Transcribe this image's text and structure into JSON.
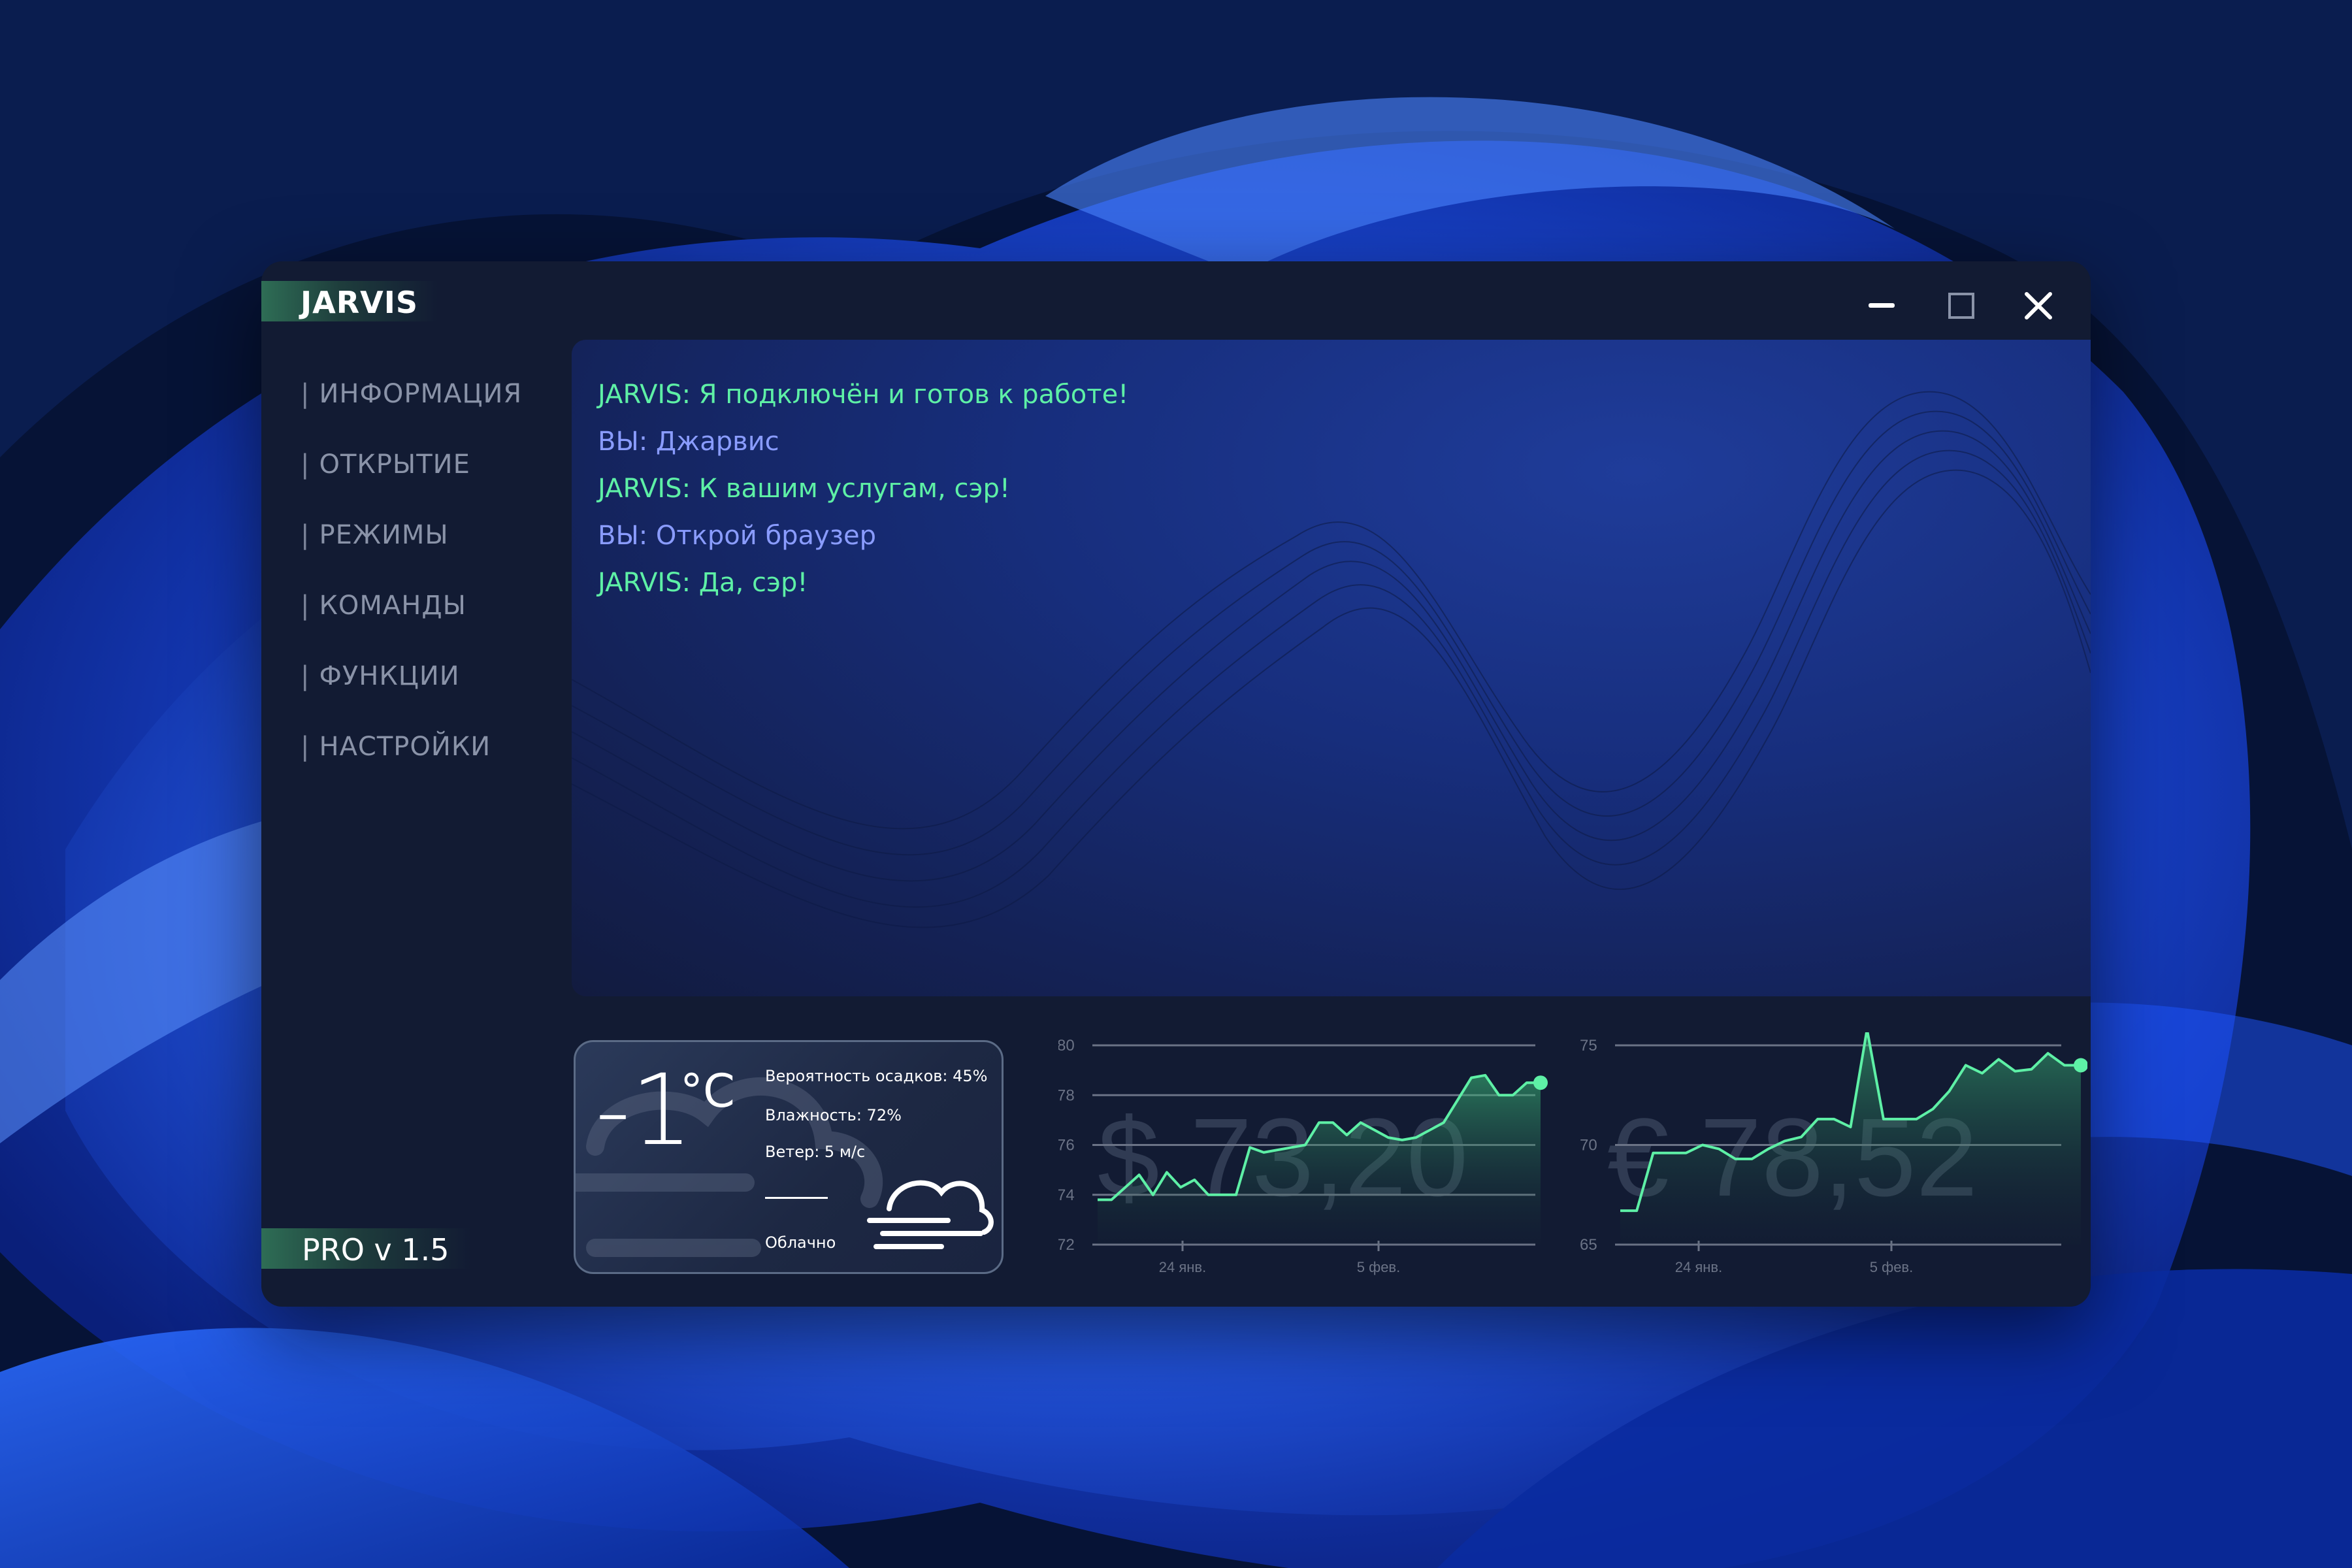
{
  "window": {
    "title": "JARVIS",
    "controls": {
      "minimize": "minimize-icon",
      "maximize": "maximize-icon",
      "close": "close-icon"
    }
  },
  "sidebar": {
    "items": [
      {
        "label": "ИНФОРМАЦИЯ"
      },
      {
        "label": "ОТКРЫТИЕ"
      },
      {
        "label": "РЕЖИМЫ"
      },
      {
        "label": "КОМАНДЫ"
      },
      {
        "label": "ФУНКЦИИ"
      },
      {
        "label": "НАСТРОЙКИ"
      }
    ],
    "version": "PRO v 1.5"
  },
  "chat": {
    "messages": [
      {
        "speaker": "jarvis",
        "text": "JARVIS: Я подключён и готов к работе!"
      },
      {
        "speaker": "user",
        "text": "ВЫ: Джарвис"
      },
      {
        "speaker": "jarvis",
        "text": "JARVIS: К вашим услугам, сэр!"
      },
      {
        "speaker": "user",
        "text": "ВЫ: Открой браузер"
      },
      {
        "speaker": "jarvis",
        "text": "JARVIS: Да, сэр!"
      }
    ]
  },
  "weather": {
    "temperature": "-1",
    "unit": "°C",
    "precipitation": "Вероятность осадков: 45%",
    "humidity": "Влажность: 72%",
    "wind": "Ветер: 5 м/с",
    "condition": "Облачно",
    "icon": "cloud-wind-icon"
  },
  "colors": {
    "accent_green": "#5ef0a6",
    "user_blue": "#8a9cff",
    "window_bg": "#121b33"
  },
  "chart_data": [
    {
      "type": "area",
      "big_label": "$ 73,20",
      "ylim": [
        72,
        80
      ],
      "yticks": [
        "80",
        "78",
        "76",
        "74",
        "72"
      ],
      "xticks": [
        "24 янв.",
        "5 фев."
      ],
      "x": [
        0,
        1,
        2,
        3,
        4,
        5,
        6,
        7,
        8,
        9,
        10,
        11,
        12,
        13,
        14,
        15,
        16,
        17,
        18,
        19,
        20,
        21,
        22,
        23,
        24,
        25,
        26,
        27,
        28,
        29,
        30,
        31,
        32
      ],
      "values": [
        73.8,
        73.8,
        74.3,
        74.8,
        74.0,
        74.9,
        74.3,
        74.6,
        74.0,
        74.0,
        74.0,
        75.9,
        75.7,
        75.8,
        75.9,
        76.0,
        76.9,
        76.9,
        76.4,
        76.9,
        76.6,
        76.3,
        76.2,
        76.3,
        76.6,
        76.9,
        77.8,
        78.7,
        78.8,
        78.0,
        78.0,
        78.5,
        78.5
      ],
      "last_point": 78.5,
      "grid": true
    },
    {
      "type": "area",
      "big_label": "€ 78,52",
      "ylim": [
        65,
        75
      ],
      "yticks": [
        "75",
        "70",
        "65"
      ],
      "xticks": [
        "24 янв.",
        "5 фев."
      ],
      "x": [
        0,
        1,
        2,
        3,
        4,
        5,
        6,
        7,
        8,
        9,
        10,
        11,
        12,
        13,
        14,
        15,
        16,
        17,
        18,
        19,
        20,
        21,
        22,
        23,
        24,
        25,
        26,
        27,
        28
      ],
      "values": [
        66.7,
        66.7,
        69.6,
        69.6,
        69.6,
        70.0,
        69.8,
        69.3,
        69.3,
        69.8,
        70.2,
        70.4,
        71.3,
        71.3,
        70.9,
        75.8,
        71.3,
        71.3,
        71.3,
        71.8,
        72.7,
        74.0,
        73.6,
        74.3,
        73.7,
        73.8,
        74.6,
        74.0,
        74.0
      ],
      "last_point": 74.0,
      "grid": true
    }
  ]
}
